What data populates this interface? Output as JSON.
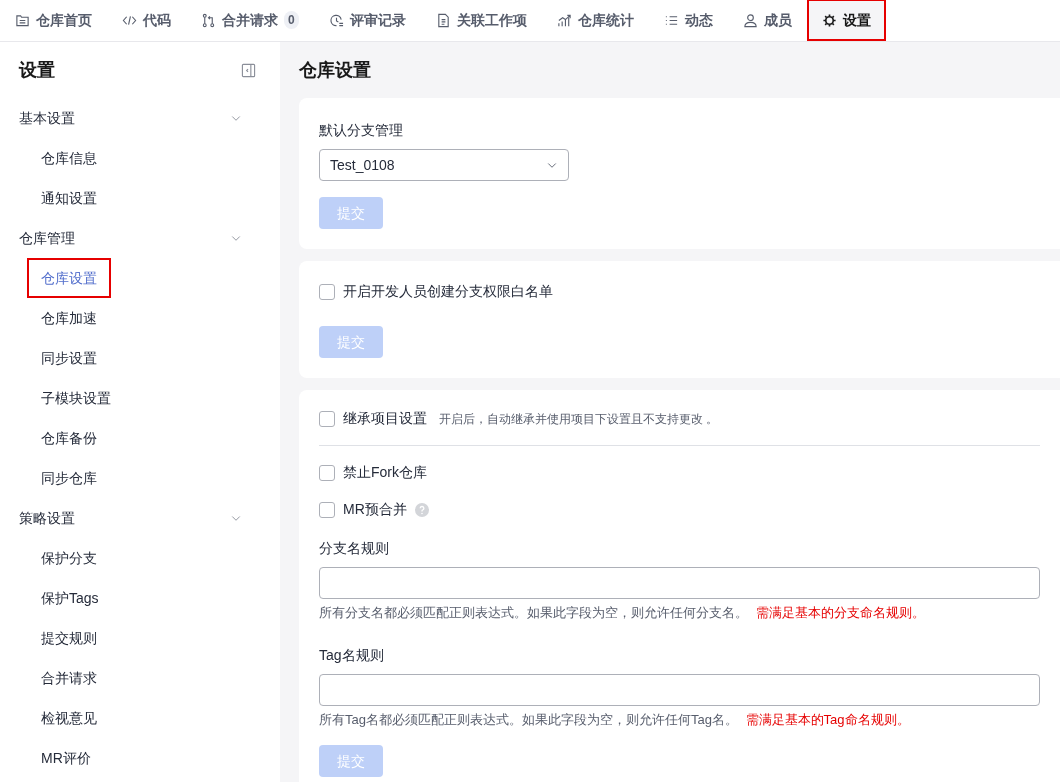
{
  "tabs": [
    {
      "label": "仓库首页",
      "selected": false,
      "highlighted": false
    },
    {
      "label": "代码",
      "selected": false,
      "highlighted": false
    },
    {
      "label": "合并请求",
      "count": "0",
      "selected": false,
      "highlighted": false
    },
    {
      "label": "评审记录",
      "selected": false,
      "highlighted": false
    },
    {
      "label": "关联工作项",
      "selected": false,
      "highlighted": false
    },
    {
      "label": "仓库统计",
      "selected": false,
      "highlighted": false
    },
    {
      "label": "动态",
      "selected": false,
      "highlighted": false
    },
    {
      "label": "成员",
      "selected": false,
      "highlighted": false
    },
    {
      "label": "设置",
      "selected": true,
      "highlighted": true
    }
  ],
  "sidebar": {
    "title": "设置",
    "groups": [
      {
        "label": "基本设置",
        "expanded": true,
        "items": [
          {
            "label": "仓库信息",
            "selected": false,
            "highlighted": false
          },
          {
            "label": "通知设置",
            "selected": false,
            "highlighted": false
          }
        ]
      },
      {
        "label": "仓库管理",
        "expanded": true,
        "items": [
          {
            "label": "仓库设置",
            "selected": true,
            "highlighted": true
          },
          {
            "label": "仓库加速",
            "selected": false,
            "highlighted": false
          },
          {
            "label": "同步设置",
            "selected": false,
            "highlighted": false
          },
          {
            "label": "子模块设置",
            "selected": false,
            "highlighted": false
          },
          {
            "label": "仓库备份",
            "selected": false,
            "highlighted": false
          },
          {
            "label": "同步仓库",
            "selected": false,
            "highlighted": false
          }
        ]
      },
      {
        "label": "策略设置",
        "expanded": true,
        "items": [
          {
            "label": "保护分支",
            "selected": false,
            "highlighted": false
          },
          {
            "label": "保护Tags",
            "selected": false,
            "highlighted": false
          },
          {
            "label": "提交规则",
            "selected": false,
            "highlighted": false
          },
          {
            "label": "合并请求",
            "selected": false,
            "highlighted": false
          },
          {
            "label": "检视意见",
            "selected": false,
            "highlighted": false
          },
          {
            "label": "MR评价",
            "selected": false,
            "highlighted": false
          }
        ]
      }
    ]
  },
  "page_title": "仓库设置",
  "default_branch": {
    "label": "默认分支管理",
    "value": "Test_0108",
    "submit": "提交",
    "submit_disabled": true
  },
  "whitelist": {
    "label": "开启开发人员创建分支权限白名单",
    "checked": false,
    "submit": "提交",
    "submit_disabled": true
  },
  "inherit": {
    "label": "继承项目设置",
    "hint": "开启后，自动继承并使用项目下设置且不支持更改 。",
    "checked": false
  },
  "options": [
    {
      "label": "禁止Fork仓库",
      "checked": false,
      "help": false
    },
    {
      "label": "MR预合并",
      "checked": false,
      "help": true
    }
  ],
  "rules": [
    {
      "label": "分支名规则",
      "hint": "所有分支名都必须匹配正则表达式。如果此字段为空，则允许任何分支名。",
      "link": "需满足基本的分支命名规则。"
    },
    {
      "label": "Tag名规则",
      "hint": "所有Tag名都必须匹配正则表达式。如果此字段为空，则允许任何Tag名。",
      "link": "需满足基本的Tag命名规则。"
    }
  ],
  "rules_submit": "提交",
  "rules_submit_disabled": true
}
